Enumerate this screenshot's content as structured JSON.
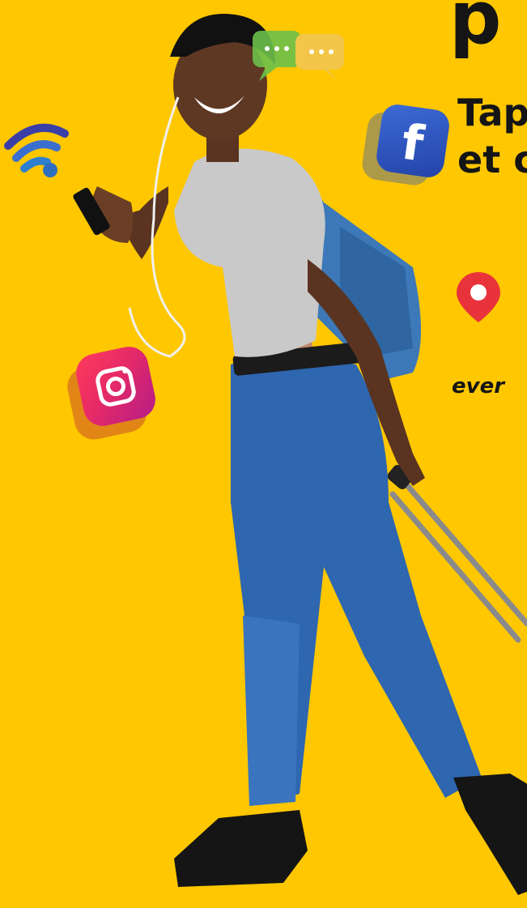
{
  "headline": {
    "top_fragment": "p",
    "line1": "Tap",
    "line2": "et c"
  },
  "tagline": "ever",
  "colors": {
    "background": "#ffc700",
    "text": "#151515"
  },
  "icons": [
    "wifi-icon",
    "chat-bubbles-icon",
    "facebook-icon",
    "location-pin-icon",
    "instagram-icon"
  ]
}
